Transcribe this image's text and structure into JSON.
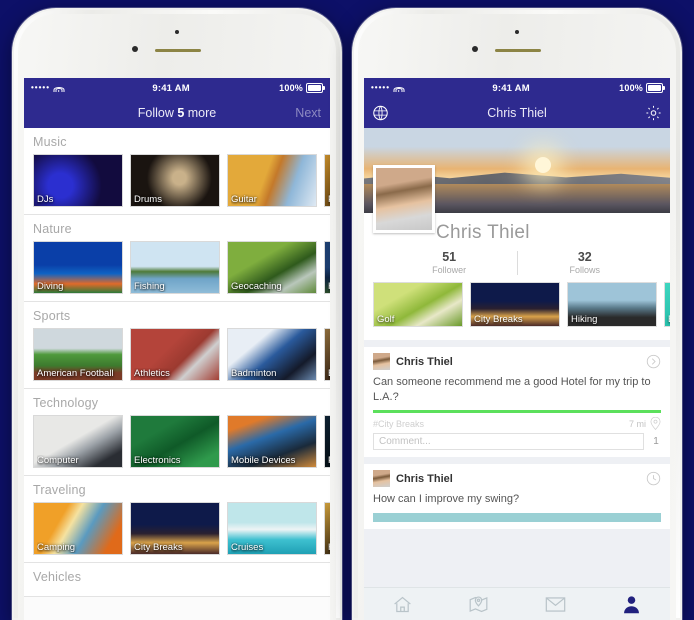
{
  "background_color": "#0d1068",
  "accent_color": "#2e2a8f",
  "status_bar": {
    "signal_dots": "•••••",
    "wifi_icon": "wifi-icon",
    "time": "9:41 AM",
    "battery_percent": "100%",
    "battery_icon": "battery-icon"
  },
  "left_phone": {
    "navbar": {
      "title_prefix": "Follow ",
      "title_count": "5",
      "title_suffix": " more",
      "right_action": "Next"
    },
    "sections": [
      {
        "title": "Music",
        "tiles": [
          {
            "label": "DJs",
            "img": "img-djs"
          },
          {
            "label": "Drums",
            "img": "img-drums"
          },
          {
            "label": "Guitar",
            "img": "img-guitar"
          },
          {
            "label": "P",
            "img": "img-piano",
            "partial": true
          }
        ]
      },
      {
        "title": "Nature",
        "tiles": [
          {
            "label": "Diving",
            "img": "img-diving"
          },
          {
            "label": "Fishing",
            "img": "img-fishing"
          },
          {
            "label": "Geocaching",
            "img": "img-geo"
          },
          {
            "label": "Hi",
            "img": "img-hiking-n",
            "partial": true
          }
        ]
      },
      {
        "title": "Sports",
        "tiles": [
          {
            "label": "American Football",
            "img": "img-afoot"
          },
          {
            "label": "Athletics",
            "img": "img-athl"
          },
          {
            "label": "Badminton",
            "img": "img-badm"
          },
          {
            "label": "Ba",
            "img": "img-base",
            "partial": true
          }
        ]
      },
      {
        "title": "Technology",
        "tiles": [
          {
            "label": "Computer",
            "img": "img-comp"
          },
          {
            "label": "Electronics",
            "img": "img-elec"
          },
          {
            "label": "Mobile Devices",
            "img": "img-mob"
          },
          {
            "label": "P",
            "img": "img-prog",
            "partial": true
          }
        ]
      },
      {
        "title": "Traveling",
        "tiles": [
          {
            "label": "Camping",
            "img": "img-camp"
          },
          {
            "label": "City Breaks",
            "img": "img-city"
          },
          {
            "label": "Cruises",
            "img": "img-cruise"
          },
          {
            "label": "H",
            "img": "img-hotels",
            "partial": true
          }
        ]
      },
      {
        "title": "Vehicles",
        "tiles": []
      }
    ]
  },
  "right_phone": {
    "navbar": {
      "left_icon": "globe-icon",
      "title": "Chris Thiel",
      "right_icon": "gear-icon"
    },
    "profile": {
      "name": "Chris Thiel",
      "follower_count": "51",
      "follower_label": "Follower",
      "follows_count": "32",
      "follows_label": "Follows",
      "interests": [
        {
          "label": "Golf",
          "img": "img-golf"
        },
        {
          "label": "City Breaks",
          "img": "img-city"
        },
        {
          "label": "Hiking",
          "img": "img-hike2"
        },
        {
          "label": "B",
          "img": "img-bball",
          "partial": true
        }
      ]
    },
    "posts": [
      {
        "author": "Chris Thiel",
        "text": "Can someone recommend me a good Hotel for my trip to L.A.?",
        "bar_color": "#5ce05c",
        "tag": "#City Breaks",
        "distance": "7 mi",
        "distance_icon": "location-pin-icon",
        "status_icon": "chevron-right-circle-icon",
        "comment_placeholder": "Comment...",
        "comment_count": "1"
      },
      {
        "author": "Chris Thiel",
        "text": "How can I improve my swing?",
        "bar_color": "#9ad0d4",
        "status_icon": "clock-icon"
      }
    ],
    "tabbar": [
      {
        "icon": "home-icon",
        "active": false
      },
      {
        "icon": "map-pin-icon",
        "active": false
      },
      {
        "icon": "envelope-icon",
        "active": false
      },
      {
        "icon": "profile-person-icon",
        "active": true
      }
    ]
  }
}
